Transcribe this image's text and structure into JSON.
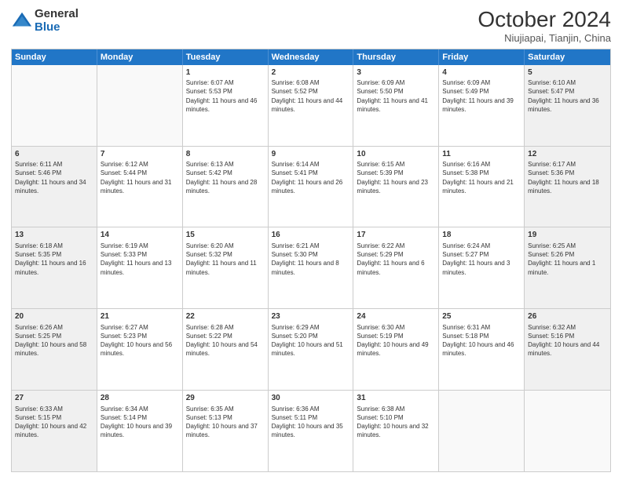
{
  "header": {
    "logo_general": "General",
    "logo_blue": "Blue",
    "month_title": "October 2024",
    "location": "Niujiapai, Tianjin, China"
  },
  "days_of_week": [
    "Sunday",
    "Monday",
    "Tuesday",
    "Wednesday",
    "Thursday",
    "Friday",
    "Saturday"
  ],
  "weeks": [
    [
      {
        "day": "",
        "empty": true
      },
      {
        "day": "",
        "empty": true
      },
      {
        "day": "1",
        "sunrise": "6:07 AM",
        "sunset": "5:53 PM",
        "daylight": "11 hours and 46 minutes."
      },
      {
        "day": "2",
        "sunrise": "6:08 AM",
        "sunset": "5:52 PM",
        "daylight": "11 hours and 44 minutes."
      },
      {
        "day": "3",
        "sunrise": "6:09 AM",
        "sunset": "5:50 PM",
        "daylight": "11 hours and 41 minutes."
      },
      {
        "day": "4",
        "sunrise": "6:09 AM",
        "sunset": "5:49 PM",
        "daylight": "11 hours and 39 minutes."
      },
      {
        "day": "5",
        "sunrise": "6:10 AM",
        "sunset": "5:47 PM",
        "daylight": "11 hours and 36 minutes."
      }
    ],
    [
      {
        "day": "6",
        "sunrise": "6:11 AM",
        "sunset": "5:46 PM",
        "daylight": "11 hours and 34 minutes."
      },
      {
        "day": "7",
        "sunrise": "6:12 AM",
        "sunset": "5:44 PM",
        "daylight": "11 hours and 31 minutes."
      },
      {
        "day": "8",
        "sunrise": "6:13 AM",
        "sunset": "5:42 PM",
        "daylight": "11 hours and 28 minutes."
      },
      {
        "day": "9",
        "sunrise": "6:14 AM",
        "sunset": "5:41 PM",
        "daylight": "11 hours and 26 minutes."
      },
      {
        "day": "10",
        "sunrise": "6:15 AM",
        "sunset": "5:39 PM",
        "daylight": "11 hours and 23 minutes."
      },
      {
        "day": "11",
        "sunrise": "6:16 AM",
        "sunset": "5:38 PM",
        "daylight": "11 hours and 21 minutes."
      },
      {
        "day": "12",
        "sunrise": "6:17 AM",
        "sunset": "5:36 PM",
        "daylight": "11 hours and 18 minutes."
      }
    ],
    [
      {
        "day": "13",
        "sunrise": "6:18 AM",
        "sunset": "5:35 PM",
        "daylight": "11 hours and 16 minutes."
      },
      {
        "day": "14",
        "sunrise": "6:19 AM",
        "sunset": "5:33 PM",
        "daylight": "11 hours and 13 minutes."
      },
      {
        "day": "15",
        "sunrise": "6:20 AM",
        "sunset": "5:32 PM",
        "daylight": "11 hours and 11 minutes."
      },
      {
        "day": "16",
        "sunrise": "6:21 AM",
        "sunset": "5:30 PM",
        "daylight": "11 hours and 8 minutes."
      },
      {
        "day": "17",
        "sunrise": "6:22 AM",
        "sunset": "5:29 PM",
        "daylight": "11 hours and 6 minutes."
      },
      {
        "day": "18",
        "sunrise": "6:24 AM",
        "sunset": "5:27 PM",
        "daylight": "11 hours and 3 minutes."
      },
      {
        "day": "19",
        "sunrise": "6:25 AM",
        "sunset": "5:26 PM",
        "daylight": "11 hours and 1 minute."
      }
    ],
    [
      {
        "day": "20",
        "sunrise": "6:26 AM",
        "sunset": "5:25 PM",
        "daylight": "10 hours and 58 minutes."
      },
      {
        "day": "21",
        "sunrise": "6:27 AM",
        "sunset": "5:23 PM",
        "daylight": "10 hours and 56 minutes."
      },
      {
        "day": "22",
        "sunrise": "6:28 AM",
        "sunset": "5:22 PM",
        "daylight": "10 hours and 54 minutes."
      },
      {
        "day": "23",
        "sunrise": "6:29 AM",
        "sunset": "5:20 PM",
        "daylight": "10 hours and 51 minutes."
      },
      {
        "day": "24",
        "sunrise": "6:30 AM",
        "sunset": "5:19 PM",
        "daylight": "10 hours and 49 minutes."
      },
      {
        "day": "25",
        "sunrise": "6:31 AM",
        "sunset": "5:18 PM",
        "daylight": "10 hours and 46 minutes."
      },
      {
        "day": "26",
        "sunrise": "6:32 AM",
        "sunset": "5:16 PM",
        "daylight": "10 hours and 44 minutes."
      }
    ],
    [
      {
        "day": "27",
        "sunrise": "6:33 AM",
        "sunset": "5:15 PM",
        "daylight": "10 hours and 42 minutes."
      },
      {
        "day": "28",
        "sunrise": "6:34 AM",
        "sunset": "5:14 PM",
        "daylight": "10 hours and 39 minutes."
      },
      {
        "day": "29",
        "sunrise": "6:35 AM",
        "sunset": "5:13 PM",
        "daylight": "10 hours and 37 minutes."
      },
      {
        "day": "30",
        "sunrise": "6:36 AM",
        "sunset": "5:11 PM",
        "daylight": "10 hours and 35 minutes."
      },
      {
        "day": "31",
        "sunrise": "6:38 AM",
        "sunset": "5:10 PM",
        "daylight": "10 hours and 32 minutes."
      },
      {
        "day": "",
        "empty": true
      },
      {
        "day": "",
        "empty": true
      }
    ]
  ],
  "labels": {
    "sunrise": "Sunrise:",
    "sunset": "Sunset:",
    "daylight": "Daylight:"
  }
}
